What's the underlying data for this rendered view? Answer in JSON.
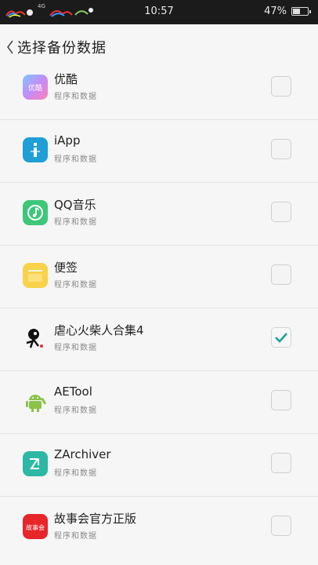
{
  "status_bar": {
    "time": "10:57",
    "battery_percent": "47%",
    "signal_label": "4G"
  },
  "header": {
    "title": "选择备份数据"
  },
  "apps": [
    {
      "name": "优酷",
      "subtitle": "程序和数据",
      "checked": false,
      "icon": "youku-icon",
      "icon_color": "#b07cf5"
    },
    {
      "name": "iApp",
      "subtitle": "程序和数据",
      "checked": false,
      "icon": "iapp-icon",
      "icon_color": "#1f9fd6"
    },
    {
      "name": "QQ音乐",
      "subtitle": "程序和数据",
      "checked": false,
      "icon": "qq-music-icon",
      "icon_color": "#3ec67a"
    },
    {
      "name": "便签",
      "subtitle": "程序和数据",
      "checked": false,
      "icon": "notes-icon",
      "icon_color": "#f8d24a"
    },
    {
      "name": "虐心火柴人合集4",
      "subtitle": "程序和数据",
      "checked": true,
      "icon": "stickman-icon",
      "icon_color": "#111111"
    },
    {
      "name": "AETool",
      "subtitle": "程序和数据",
      "checked": false,
      "icon": "android-icon",
      "icon_color": "#8bc34a"
    },
    {
      "name": "ZArchiver",
      "subtitle": "程序和数据",
      "checked": false,
      "icon": "zarchiver-icon",
      "icon_color": "#2cb8a4"
    },
    {
      "name": "故事会官方正版",
      "subtitle": "程序和数据",
      "checked": false,
      "icon": "gushihui-icon",
      "icon_color": "#e6262b"
    }
  ],
  "colors": {
    "check_mark": "#1aa394",
    "status_bar_bg": "#1b1b1b",
    "background": "#f6f6f6"
  }
}
